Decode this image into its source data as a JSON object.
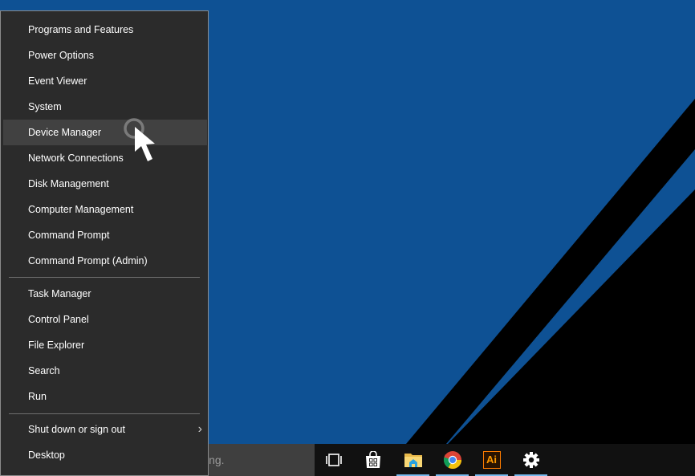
{
  "colors": {
    "wallpaper_blue": "#0e5194",
    "wallpaper_black": "#000000",
    "menu_bg": "#2b2b2b",
    "menu_hover": "#414141",
    "taskbar_bg": "#111111",
    "running_indicator": "#76b9ed"
  },
  "menu": {
    "group1": [
      {
        "label": "Programs and Features"
      },
      {
        "label": "Power Options"
      },
      {
        "label": "Event Viewer"
      },
      {
        "label": "System"
      },
      {
        "label": "Device Manager",
        "hovered": true
      },
      {
        "label": "Network Connections"
      },
      {
        "label": "Disk Management"
      },
      {
        "label": "Computer Management"
      },
      {
        "label": "Command Prompt"
      },
      {
        "label": "Command Prompt (Admin)"
      }
    ],
    "group2": [
      {
        "label": "Task Manager"
      },
      {
        "label": "Control Panel"
      },
      {
        "label": "File Explorer"
      },
      {
        "label": "Search"
      },
      {
        "label": "Run"
      }
    ],
    "group3": [
      {
        "label": "Shut down or sign out",
        "submenu_icon": "chevron-right-icon"
      },
      {
        "label": "Desktop"
      }
    ]
  },
  "taskbar": {
    "search_placeholder_visible": "ing.",
    "items": [
      {
        "name": "task-view",
        "icon": "task-view-icon",
        "running": false
      },
      {
        "name": "store",
        "icon": "store-icon",
        "running": false
      },
      {
        "name": "file-explorer",
        "icon": "folder-icon",
        "running": true
      },
      {
        "name": "chrome",
        "icon": "chrome-icon",
        "running": true
      },
      {
        "name": "illustrator",
        "icon": "illustrator-icon",
        "label": "Ai",
        "running": true
      },
      {
        "name": "settings",
        "icon": "gear-icon",
        "running": true
      }
    ]
  },
  "chevron": "›"
}
